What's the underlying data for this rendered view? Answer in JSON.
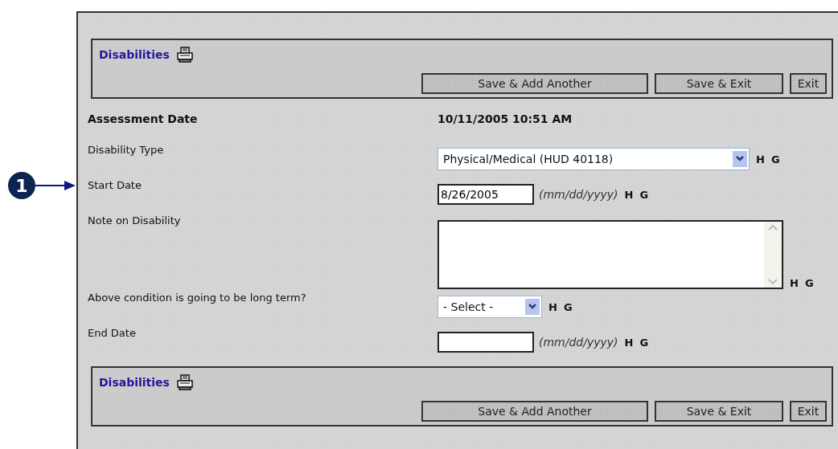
{
  "callout": {
    "number": "1"
  },
  "header": {
    "title": "Disabilities",
    "buttons": [
      "Save & Add Another",
      "Save & Exit",
      "Exit"
    ]
  },
  "fields": [
    {
      "kind": "text",
      "label": "Assessment Date",
      "value": "10/11/2005  10:51 AM"
    },
    {
      "kind": "select",
      "label": "Disability Type",
      "value": "Physical/Medical (HUD 40118)",
      "flags": [
        "H",
        "G"
      ]
    },
    {
      "kind": "date",
      "label": "Start Date",
      "value": "8/26/2005",
      "hint": "(mm/dd/yyyy)",
      "flags": [
        "H",
        "G"
      ]
    },
    {
      "kind": "textarea",
      "label": "Note on Disability",
      "flags": [
        "H",
        "G"
      ]
    },
    {
      "kind": "select-small",
      "label": "Above condition is going to be long term?",
      "value": "- Select -",
      "flags": [
        "H",
        "G"
      ]
    },
    {
      "kind": "date",
      "label": "End Date",
      "hint": "(mm/dd/yyyy)",
      "flags": [
        "H",
        "G"
      ]
    }
  ],
  "footer": {
    "title": "Disabilities",
    "buttons": [
      "Save & Add Another",
      "Save & Exit",
      "Exit"
    ]
  }
}
